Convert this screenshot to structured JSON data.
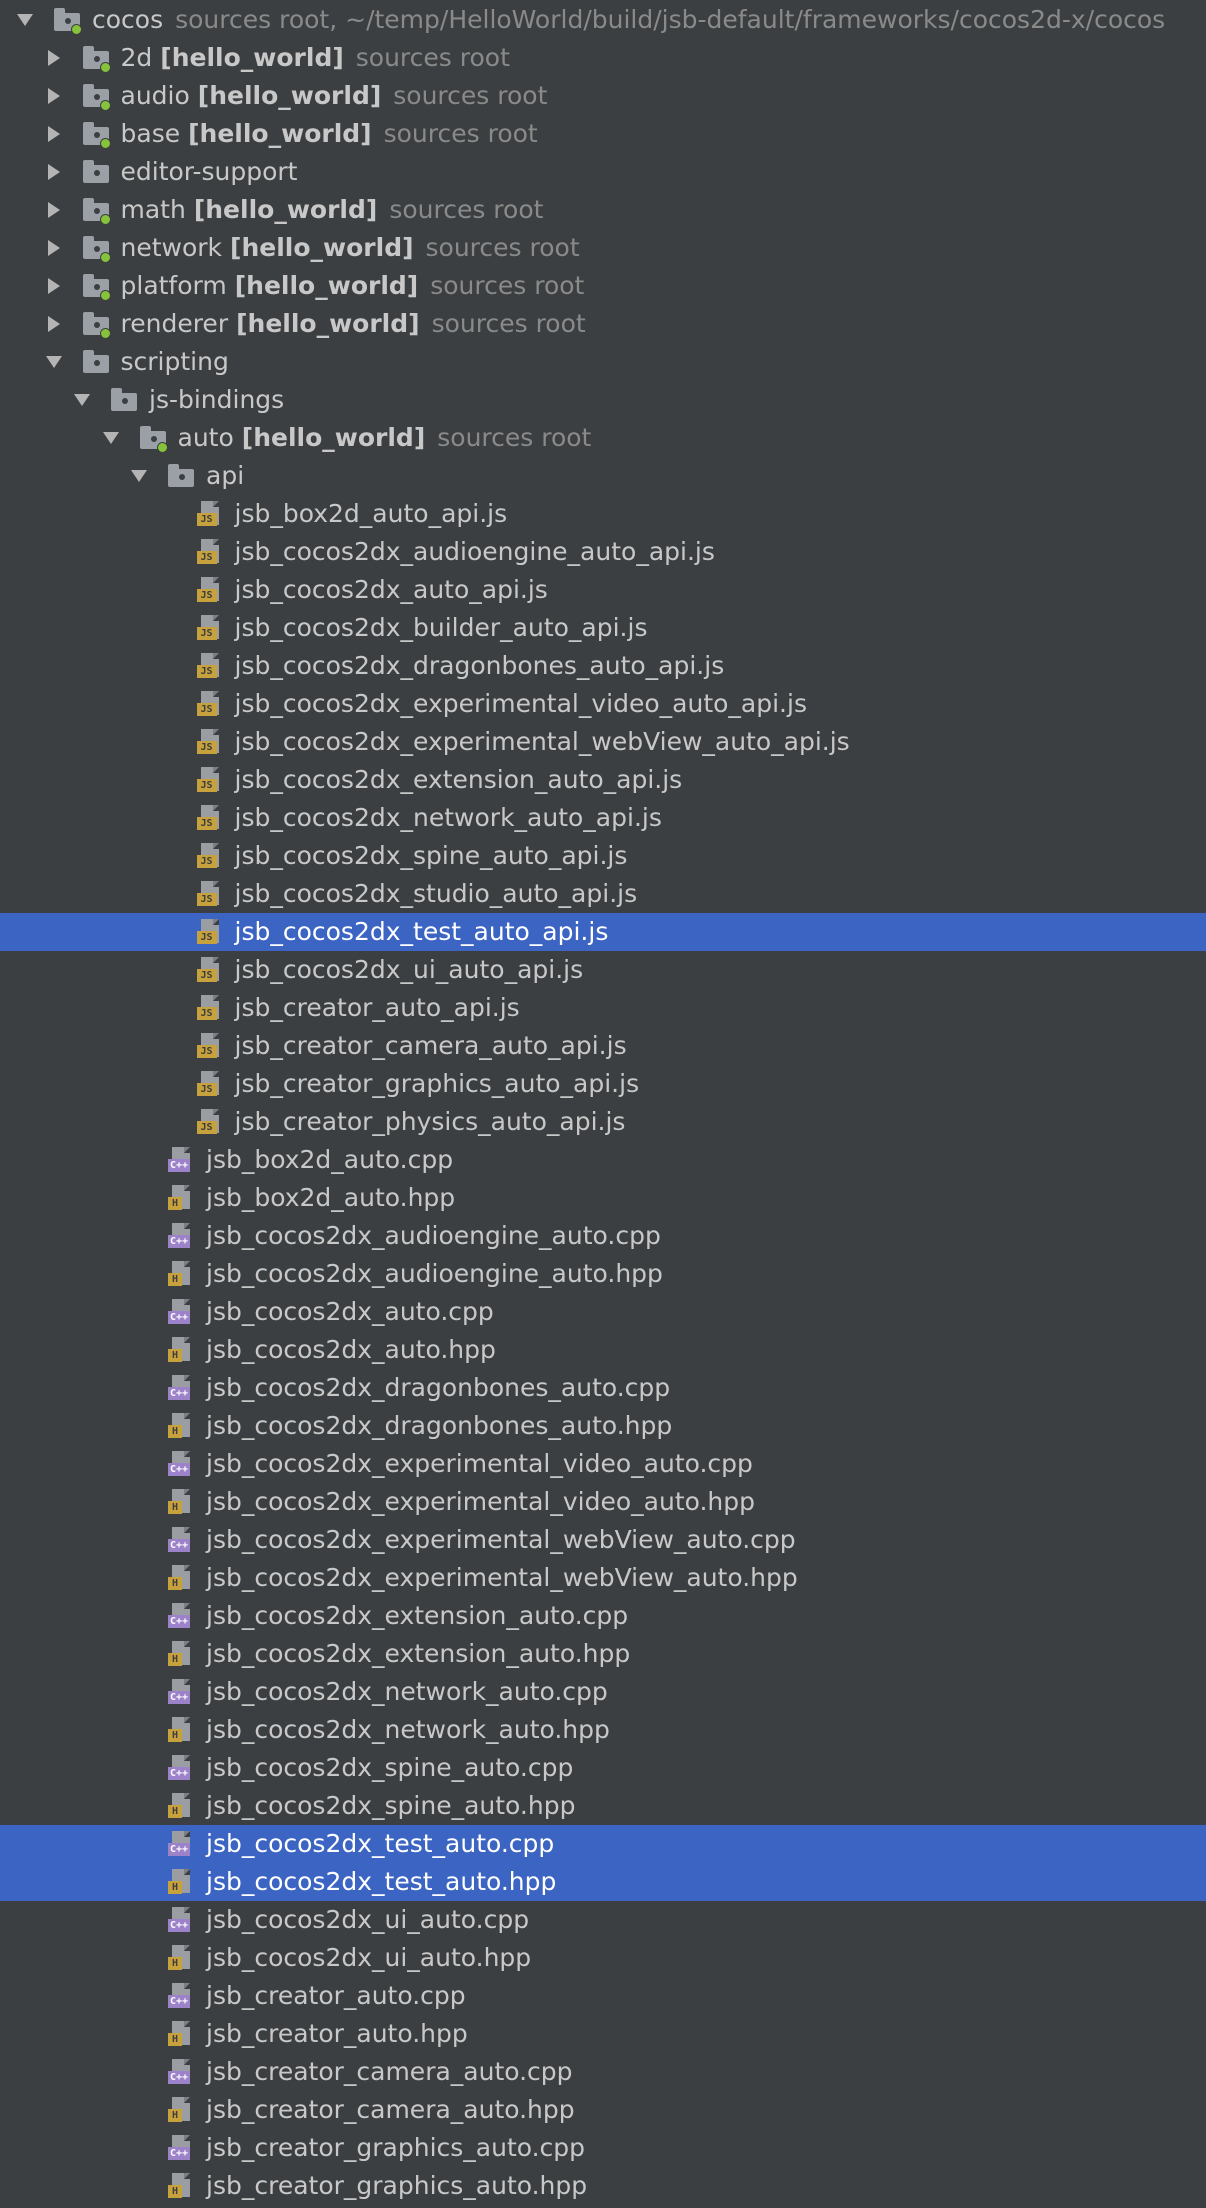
{
  "colors": {
    "background": "#3c3f41",
    "selection": "#3b64c3",
    "source_root_dot": "#86c23a",
    "js_badge": "#c7a13b",
    "cpp_badge": "#9b82c9",
    "hpp_badge": "#c7a13b"
  },
  "tree": [
    {
      "name": "cocos",
      "note": "sources root,  ~/temp/HelloWorld/build/jsb-default/frameworks/cocos2d-x/cocos",
      "type": "folder",
      "source_root": true,
      "expanded": true,
      "depth": 0
    },
    {
      "name": "2d",
      "module": "[hello_world]",
      "note": "sources root",
      "type": "folder",
      "source_root": true,
      "expanded": false,
      "depth": 1
    },
    {
      "name": "audio",
      "module": "[hello_world]",
      "note": "sources root",
      "type": "folder",
      "source_root": true,
      "expanded": false,
      "depth": 1
    },
    {
      "name": "base",
      "module": "[hello_world]",
      "note": "sources root",
      "type": "folder",
      "source_root": true,
      "expanded": false,
      "depth": 1
    },
    {
      "name": "editor-support",
      "type": "folder",
      "source_root": false,
      "expanded": false,
      "depth": 1
    },
    {
      "name": "math",
      "module": "[hello_world]",
      "note": "sources root",
      "type": "folder",
      "source_root": true,
      "expanded": false,
      "depth": 1
    },
    {
      "name": "network",
      "module": "[hello_world]",
      "note": "sources root",
      "type": "folder",
      "source_root": true,
      "expanded": false,
      "depth": 1
    },
    {
      "name": "platform",
      "module": "[hello_world]",
      "note": "sources root",
      "type": "folder",
      "source_root": true,
      "expanded": false,
      "depth": 1
    },
    {
      "name": "renderer",
      "module": "[hello_world]",
      "note": "sources root",
      "type": "folder",
      "source_root": true,
      "expanded": false,
      "depth": 1
    },
    {
      "name": "scripting",
      "type": "folder",
      "source_root": false,
      "expanded": true,
      "depth": 1
    },
    {
      "name": "js-bindings",
      "type": "folder",
      "source_root": false,
      "expanded": true,
      "depth": 2
    },
    {
      "name": "auto",
      "module": "[hello_world]",
      "note": "sources root",
      "type": "folder",
      "source_root": true,
      "expanded": true,
      "depth": 3
    },
    {
      "name": "api",
      "type": "folder",
      "source_root": false,
      "expanded": true,
      "depth": 4
    },
    {
      "name": "jsb_box2d_auto_api.js",
      "type": "js",
      "depth": 5
    },
    {
      "name": "jsb_cocos2dx_audioengine_auto_api.js",
      "type": "js",
      "depth": 5
    },
    {
      "name": "jsb_cocos2dx_auto_api.js",
      "type": "js",
      "depth": 5
    },
    {
      "name": "jsb_cocos2dx_builder_auto_api.js",
      "type": "js",
      "depth": 5
    },
    {
      "name": "jsb_cocos2dx_dragonbones_auto_api.js",
      "type": "js",
      "depth": 5
    },
    {
      "name": "jsb_cocos2dx_experimental_video_auto_api.js",
      "type": "js",
      "depth": 5
    },
    {
      "name": "jsb_cocos2dx_experimental_webView_auto_api.js",
      "type": "js",
      "depth": 5
    },
    {
      "name": "jsb_cocos2dx_extension_auto_api.js",
      "type": "js",
      "depth": 5
    },
    {
      "name": "jsb_cocos2dx_network_auto_api.js",
      "type": "js",
      "depth": 5
    },
    {
      "name": "jsb_cocos2dx_spine_auto_api.js",
      "type": "js",
      "depth": 5
    },
    {
      "name": "jsb_cocos2dx_studio_auto_api.js",
      "type": "js",
      "depth": 5
    },
    {
      "name": "jsb_cocos2dx_test_auto_api.js",
      "type": "js",
      "depth": 5,
      "selected": true
    },
    {
      "name": "jsb_cocos2dx_ui_auto_api.js",
      "type": "js",
      "depth": 5
    },
    {
      "name": "jsb_creator_auto_api.js",
      "type": "js",
      "depth": 5
    },
    {
      "name": "jsb_creator_camera_auto_api.js",
      "type": "js",
      "depth": 5
    },
    {
      "name": "jsb_creator_graphics_auto_api.js",
      "type": "js",
      "depth": 5
    },
    {
      "name": "jsb_creator_physics_auto_api.js",
      "type": "js",
      "depth": 5
    },
    {
      "name": "jsb_box2d_auto.cpp",
      "type": "cpp",
      "depth": 4
    },
    {
      "name": "jsb_box2d_auto.hpp",
      "type": "hpp",
      "depth": 4
    },
    {
      "name": "jsb_cocos2dx_audioengine_auto.cpp",
      "type": "cpp",
      "depth": 4
    },
    {
      "name": "jsb_cocos2dx_audioengine_auto.hpp",
      "type": "hpp",
      "depth": 4
    },
    {
      "name": "jsb_cocos2dx_auto.cpp",
      "type": "cpp",
      "depth": 4
    },
    {
      "name": "jsb_cocos2dx_auto.hpp",
      "type": "hpp",
      "depth": 4
    },
    {
      "name": "jsb_cocos2dx_dragonbones_auto.cpp",
      "type": "cpp",
      "depth": 4
    },
    {
      "name": "jsb_cocos2dx_dragonbones_auto.hpp",
      "type": "hpp",
      "depth": 4
    },
    {
      "name": "jsb_cocos2dx_experimental_video_auto.cpp",
      "type": "cpp",
      "depth": 4
    },
    {
      "name": "jsb_cocos2dx_experimental_video_auto.hpp",
      "type": "hpp",
      "depth": 4
    },
    {
      "name": "jsb_cocos2dx_experimental_webView_auto.cpp",
      "type": "cpp",
      "depth": 4
    },
    {
      "name": "jsb_cocos2dx_experimental_webView_auto.hpp",
      "type": "hpp",
      "depth": 4
    },
    {
      "name": "jsb_cocos2dx_extension_auto.cpp",
      "type": "cpp",
      "depth": 4
    },
    {
      "name": "jsb_cocos2dx_extension_auto.hpp",
      "type": "hpp",
      "depth": 4
    },
    {
      "name": "jsb_cocos2dx_network_auto.cpp",
      "type": "cpp",
      "depth": 4
    },
    {
      "name": "jsb_cocos2dx_network_auto.hpp",
      "type": "hpp",
      "depth": 4
    },
    {
      "name": "jsb_cocos2dx_spine_auto.cpp",
      "type": "cpp",
      "depth": 4
    },
    {
      "name": "jsb_cocos2dx_spine_auto.hpp",
      "type": "hpp",
      "depth": 4
    },
    {
      "name": "jsb_cocos2dx_test_auto.cpp",
      "type": "cpp",
      "depth": 4,
      "selected": true
    },
    {
      "name": "jsb_cocos2dx_test_auto.hpp",
      "type": "hpp",
      "depth": 4,
      "selected": true
    },
    {
      "name": "jsb_cocos2dx_ui_auto.cpp",
      "type": "cpp",
      "depth": 4
    },
    {
      "name": "jsb_cocos2dx_ui_auto.hpp",
      "type": "hpp",
      "depth": 4
    },
    {
      "name": "jsb_creator_auto.cpp",
      "type": "cpp",
      "depth": 4
    },
    {
      "name": "jsb_creator_auto.hpp",
      "type": "hpp",
      "depth": 4
    },
    {
      "name": "jsb_creator_camera_auto.cpp",
      "type": "cpp",
      "depth": 4
    },
    {
      "name": "jsb_creator_camera_auto.hpp",
      "type": "hpp",
      "depth": 4
    },
    {
      "name": "jsb_creator_graphics_auto.cpp",
      "type": "cpp",
      "depth": 4
    },
    {
      "name": "jsb_creator_graphics_auto.hpp",
      "type": "hpp",
      "depth": 4
    }
  ],
  "badges": {
    "js": "JS",
    "cpp": "C++",
    "hpp": "H"
  }
}
